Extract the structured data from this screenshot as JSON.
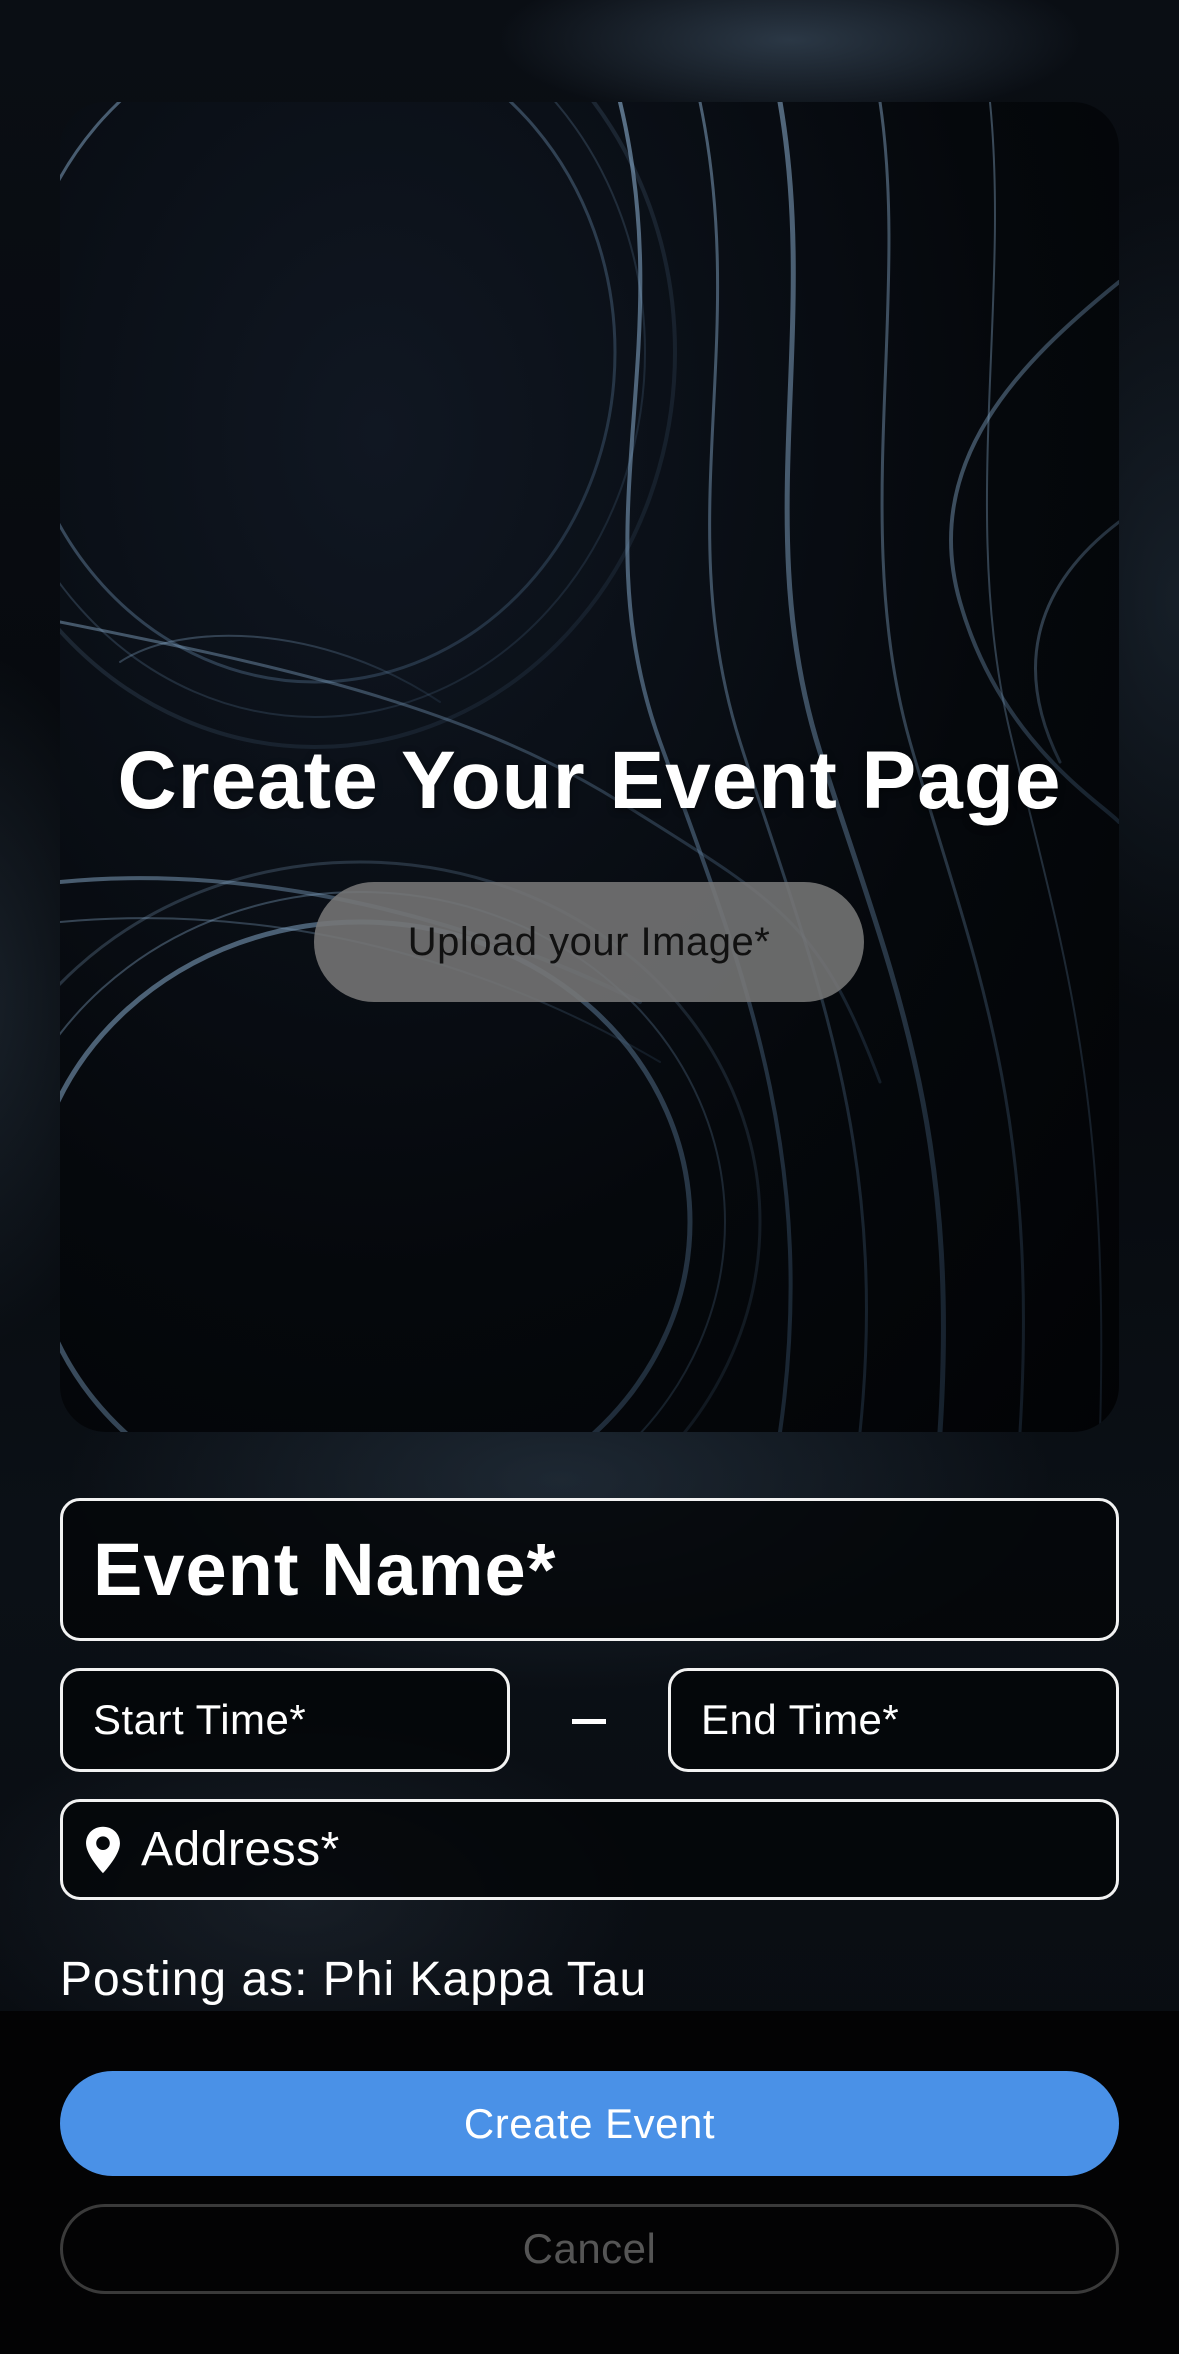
{
  "hero": {
    "title": "Create Your Event Page",
    "upload_label": "Upload your Image*"
  },
  "form": {
    "event_name_placeholder": "Event Name*",
    "start_time_placeholder": "Start Time*",
    "end_time_placeholder": "End Time*",
    "address_placeholder": "Address*",
    "address_icon": "location-pin-icon"
  },
  "posting_as": "Posting as: Phi Kappa Tau",
  "actions": {
    "create_label": "Create Event",
    "cancel_label": "Cancel"
  },
  "colors": {
    "accent": "#4a91e7",
    "upload_button": "#767676",
    "field_border": "#f2f2f2",
    "background": "#05070a"
  }
}
